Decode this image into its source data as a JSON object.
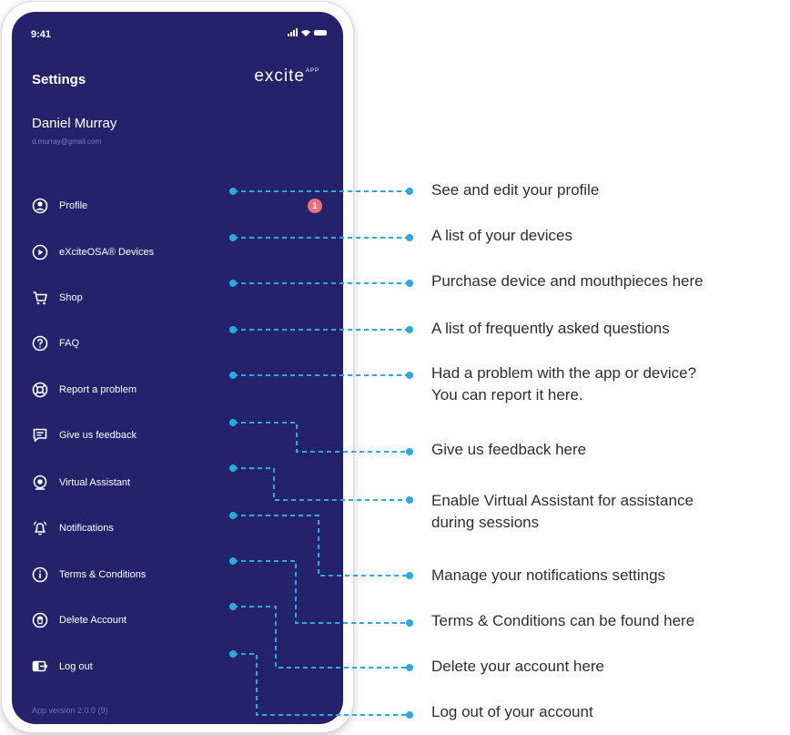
{
  "status_bar": {
    "time": "9:41"
  },
  "header": {
    "title": "Settings",
    "logo_text": "excite",
    "logo_superscript": "APP"
  },
  "user": {
    "name": "Daniel Murray",
    "email": "d.murray@gmail.com"
  },
  "menu": [
    {
      "label": "Profile",
      "icon": "user-circle-icon",
      "badge": "1"
    },
    {
      "label": "eXciteOSA® Devices",
      "icon": "play-circle-icon"
    },
    {
      "label": "Shop",
      "icon": "cart-icon"
    },
    {
      "label": "FAQ",
      "icon": "question-circle-icon"
    },
    {
      "label": "Report a problem",
      "icon": "lifebuoy-icon"
    },
    {
      "label": "Give us feedback",
      "icon": "chat-icon"
    },
    {
      "label": "Virtual Assistant",
      "icon": "webcam-icon"
    },
    {
      "label": "Notifications",
      "icon": "bell-icon"
    },
    {
      "label": "Terms & Conditions",
      "icon": "info-circle-icon"
    },
    {
      "label": "Delete Account",
      "icon": "trash-icon"
    },
    {
      "label": "Log out",
      "icon": "logout-icon"
    }
  ],
  "app_version": "App version 2.0.0 (9)",
  "callouts": [
    {
      "lines": [
        "See and edit your profile"
      ]
    },
    {
      "lines": [
        "A list of your devices"
      ]
    },
    {
      "lines": [
        "Purchase device and mouthpieces here"
      ]
    },
    {
      "lines": [
        "A list of frequently asked questions"
      ]
    },
    {
      "lines": [
        "Had a problem with the app or device?",
        "You can report it here."
      ]
    },
    {
      "lines": [
        "Give us feedback here"
      ]
    },
    {
      "lines": [
        "Enable Virtual Assistant for assistance",
        "during sessions"
      ]
    },
    {
      "lines": [
        "Manage your notifications settings"
      ]
    },
    {
      "lines": [
        "Terms & Conditions can be found here"
      ]
    },
    {
      "lines": [
        "Delete your account here"
      ]
    },
    {
      "lines": [
        "Log out of your account"
      ]
    }
  ],
  "colors": {
    "screen_bg": "#23226b",
    "connector": "#29a9e0",
    "badge": "#f0707a",
    "callout_text": "#2e2e2e"
  }
}
